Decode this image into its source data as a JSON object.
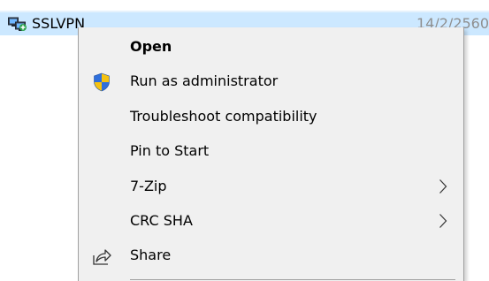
{
  "file_row": {
    "name": "SSLVPN",
    "date": "14/2/2560",
    "icon": "network-connection-icon"
  },
  "context_menu": {
    "items": [
      {
        "label": "Open",
        "default": true
      },
      {
        "label": "Run as administrator",
        "icon": "uac-shield-icon"
      },
      {
        "label": "Troubleshoot compatibility"
      },
      {
        "label": "Pin to Start"
      },
      {
        "label": "7-Zip",
        "submenu": true
      },
      {
        "label": "CRC SHA",
        "submenu": true
      },
      {
        "label": "Share",
        "icon": "share-icon"
      }
    ]
  },
  "colors": {
    "selection": "#cce8ff",
    "menu_background": "#f0f0f0",
    "menu_border": "#a0a0a0",
    "date_text": "#8f8f8f",
    "shield_blue": "#2f6fdc",
    "shield_yellow": "#f5c211"
  }
}
